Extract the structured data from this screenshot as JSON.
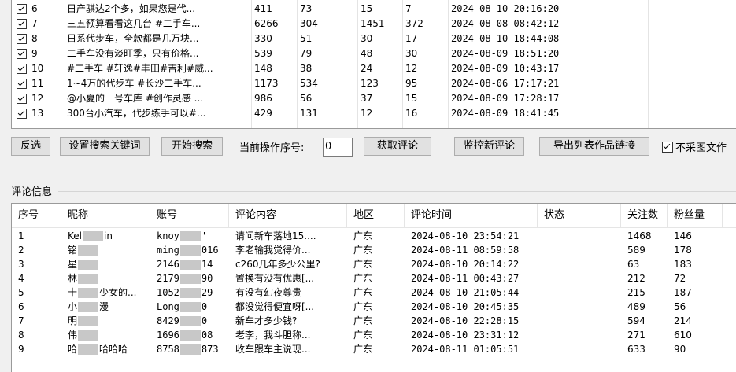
{
  "top_rows": [
    {
      "no": "6",
      "title": "日产骐达2个多，如果您是代...",
      "c1": "411",
      "c2": "73",
      "c3": "15",
      "c4": "7",
      "time": "2024-08-10 20:16:20"
    },
    {
      "no": "7",
      "title": "三五预算看看这几台 #二手车...",
      "c1": "6266",
      "c2": "304",
      "c3": "1451",
      "c4": "372",
      "time": "2024-08-08 08:42:12"
    },
    {
      "no": "8",
      "title": "日系代步车，全款都是几万块...",
      "c1": "330",
      "c2": "51",
      "c3": "30",
      "c4": "17",
      "time": "2024-08-10 18:44:08"
    },
    {
      "no": "9",
      "title": "二手车没有淡旺季，只有价格...",
      "c1": "539",
      "c2": "79",
      "c3": "48",
      "c4": "30",
      "time": "2024-08-09 18:51:20"
    },
    {
      "no": "10",
      "title": "#二手车 #轩逸#丰田#吉利#威...",
      "c1": "148",
      "c2": "38",
      "c3": "24",
      "c4": "12",
      "time": "2024-08-09 10:43:17"
    },
    {
      "no": "11",
      "title": "1~4万的代步车 #长沙二手车...",
      "c1": "1173",
      "c2": "534",
      "c3": "123",
      "c4": "95",
      "time": "2024-08-06 17:17:21"
    },
    {
      "no": "12",
      "title": "@小夏的一号车库 #创作灵感 ...",
      "c1": "986",
      "c2": "56",
      "c3": "37",
      "c4": "15",
      "time": "2024-08-09 17:28:17"
    },
    {
      "no": "13",
      "title": "300台小汽车，代步练手可以#...",
      "c1": "429",
      "c2": "131",
      "c3": "12",
      "c4": "16",
      "time": "2024-08-09 18:41:45"
    }
  ],
  "toolbar": {
    "invert": "反选",
    "set_keyword": "设置搜索关键词",
    "start_search": "开始搜索",
    "current_label": "当前操作序号:",
    "current_value": "0",
    "get_comments": "获取评论",
    "monitor": "监控新评论",
    "export_links": "导出列表作品链接",
    "no_img_label": "不采图文作"
  },
  "comments_group": "评论信息",
  "comment_headers": [
    "序号",
    "昵称",
    "账号",
    "评论内容",
    "地区",
    "评论时间",
    "状态",
    "关注数",
    "粉丝量"
  ],
  "comments": [
    {
      "no": "1",
      "nick_a": "Kel",
      "nick_b": "in",
      "acct_a": "knoy",
      "acct_b": "'",
      "content": "请问新车落地15....",
      "region": "广东",
      "time": "2024-08-10 23:54:21",
      "status": "",
      "follow": "1468",
      "fans": "146"
    },
    {
      "no": "2",
      "nick_a": "铭",
      "nick_b": "",
      "acct_a": "ming",
      "acct_b": "016",
      "content": "李老输我觉得价...",
      "region": "广东",
      "time": "2024-08-11 08:59:58",
      "status": "",
      "follow": "589",
      "fans": "178"
    },
    {
      "no": "3",
      "nick_a": "星",
      "nick_b": "",
      "acct_a": "2146",
      "acct_b": "14",
      "content": "c260几年多少公里?",
      "region": "广东",
      "time": "2024-08-10 20:14:22",
      "status": "",
      "follow": "63",
      "fans": "183"
    },
    {
      "no": "4",
      "nick_a": "林",
      "nick_b": "",
      "acct_a": "2179",
      "acct_b": "90",
      "content": "置换有没有优惠[...",
      "region": "广东",
      "time": "2024-08-11 00:43:27",
      "status": "",
      "follow": "212",
      "fans": "72"
    },
    {
      "no": "5",
      "nick_a": "十",
      "nick_b": "少女的...",
      "acct_a": "1052",
      "acct_b": "29",
      "content": "有没有幻夜尊贵",
      "region": "广东",
      "time": "2024-08-10 21:05:44",
      "status": "",
      "follow": "215",
      "fans": "187"
    },
    {
      "no": "6",
      "nick_a": "小",
      "nick_b": "漫",
      "acct_a": "Long",
      "acct_b": "0",
      "content": "都没觉得便宜呀[...",
      "region": "广东",
      "time": "2024-08-10 20:45:35",
      "status": "",
      "follow": "489",
      "fans": "56"
    },
    {
      "no": "7",
      "nick_a": "明",
      "nick_b": "",
      "acct_a": "8429",
      "acct_b": "0",
      "content": "新车才多少钱?",
      "region": "广东",
      "time": "2024-08-10 22:28:15",
      "status": "",
      "follow": "594",
      "fans": "214"
    },
    {
      "no": "8",
      "nick_a": "伟",
      "nick_b": "",
      "acct_a": "1696",
      "acct_b": "08",
      "content": "老李，我斗胆称...",
      "region": "广东",
      "time": "2024-08-10 23:31:12",
      "status": "",
      "follow": "271",
      "fans": "610"
    },
    {
      "no": "9",
      "nick_a": "哈",
      "nick_b": "哈哈哈",
      "acct_a": "8758",
      "acct_b": "873",
      "content": "收车跟车主说现...",
      "region": "广东",
      "time": "2024-08-11 01:05:51",
      "status": "",
      "follow": "633",
      "fans": "90"
    }
  ]
}
